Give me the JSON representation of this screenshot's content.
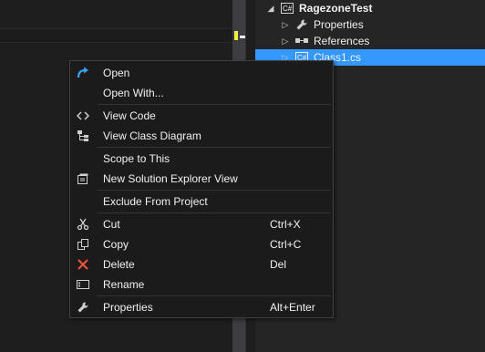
{
  "explorer": {
    "project": "RagezoneTest",
    "project_icon": "C#",
    "items": [
      {
        "label": "Properties",
        "icon": "wrench-icon"
      },
      {
        "label": "References",
        "icon": "references-icon"
      },
      {
        "label": "Class1.cs",
        "icon": "C#"
      }
    ]
  },
  "menu": {
    "items": [
      {
        "label": "Open",
        "shortcut": ""
      },
      {
        "label": "Open With...",
        "shortcut": ""
      },
      {
        "label": "View Code",
        "shortcut": ""
      },
      {
        "label": "View Class Diagram",
        "shortcut": ""
      },
      {
        "label": "Scope to This",
        "shortcut": ""
      },
      {
        "label": "New Solution Explorer View",
        "shortcut": ""
      },
      {
        "label": "Exclude From Project",
        "shortcut": ""
      },
      {
        "label": "Cut",
        "shortcut": "Ctrl+X"
      },
      {
        "label": "Copy",
        "shortcut": "Ctrl+C"
      },
      {
        "label": "Delete",
        "shortcut": "Del"
      },
      {
        "label": "Rename",
        "shortcut": ""
      },
      {
        "label": "Properties",
        "shortcut": "Alt+Enter"
      }
    ]
  },
  "colors": {
    "selection": "#3399ff",
    "menu_bg": "#1b1b1c",
    "delete_icon": "#e8523f",
    "open_icon": "#3ea2f0"
  }
}
